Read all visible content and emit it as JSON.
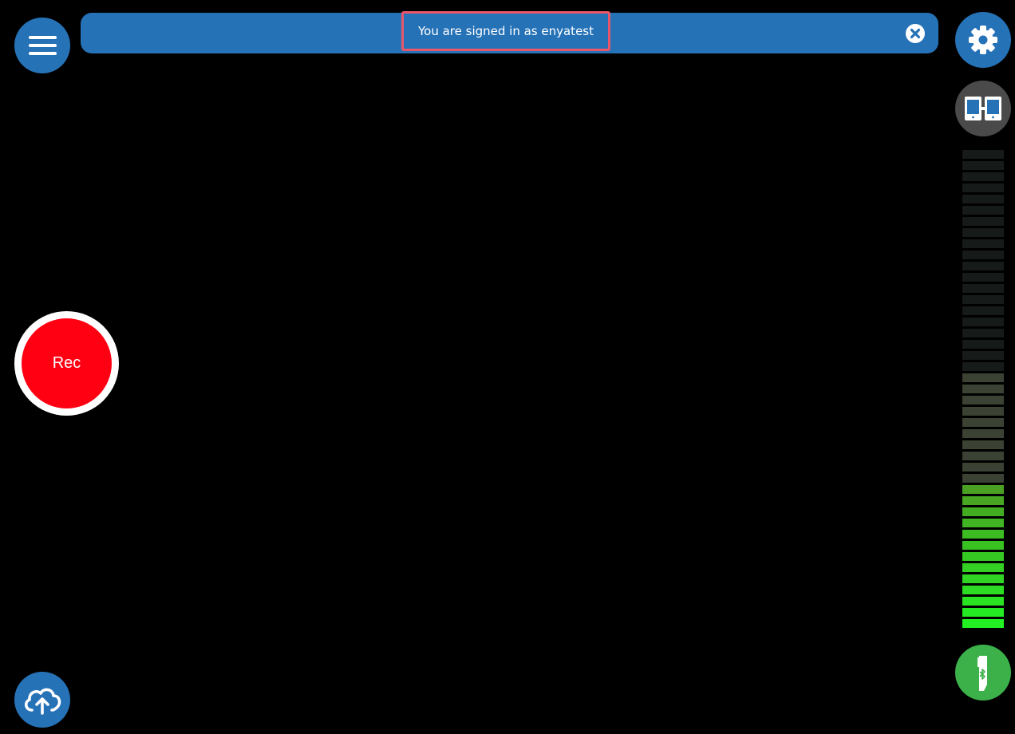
{
  "banner": {
    "message": "You are signed in as enyatest",
    "color": "#2672b7"
  },
  "record_button": {
    "label": "Rec",
    "color": "#ff0013"
  },
  "colors": {
    "accent_blue": "#2672b7",
    "monitor_gray": "#4a4a4a",
    "device_green": "#3cb14a",
    "highlight_border": "#e8566a"
  },
  "icons": {
    "menu": "hamburger-menu-icon",
    "settings": "gear-icon",
    "monitor": "dual-device-icon",
    "upload": "cloud-upload-icon",
    "close": "close-icon",
    "device": "bluetooth-device-icon"
  },
  "level_meter": {
    "segments": 43,
    "level_fraction": 0.3
  }
}
